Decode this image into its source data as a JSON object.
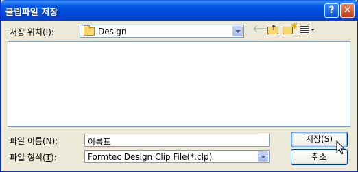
{
  "window": {
    "title": "클립파일 저장",
    "help_label": "?",
    "close_label": "✕"
  },
  "save_location": {
    "label_prefix": "저장 위치(",
    "label_key": "I",
    "label_suffix": "):",
    "value": "Design"
  },
  "file_name": {
    "label_prefix": "파일 이름(",
    "label_key": "N",
    "label_suffix": "):",
    "value": "이름표"
  },
  "file_type": {
    "label_prefix": "파일 형식(",
    "label_key": "T",
    "label_suffix": "):",
    "value": "Formtec Design Clip File(*.clp)"
  },
  "buttons": {
    "save_prefix": "저장(",
    "save_key": "S",
    "save_suffix": ")",
    "cancel": "취소"
  },
  "toolbar": {
    "back_icon": "back-arrow-icon",
    "up_icon": "up-folder-icon",
    "new_folder_icon": "new-folder-icon",
    "view_icon": "view-menu-icon"
  },
  "colors": {
    "titlebar": "#0054e3",
    "dialog_bg": "#ece9d8",
    "field_border": "#7f9db9"
  }
}
